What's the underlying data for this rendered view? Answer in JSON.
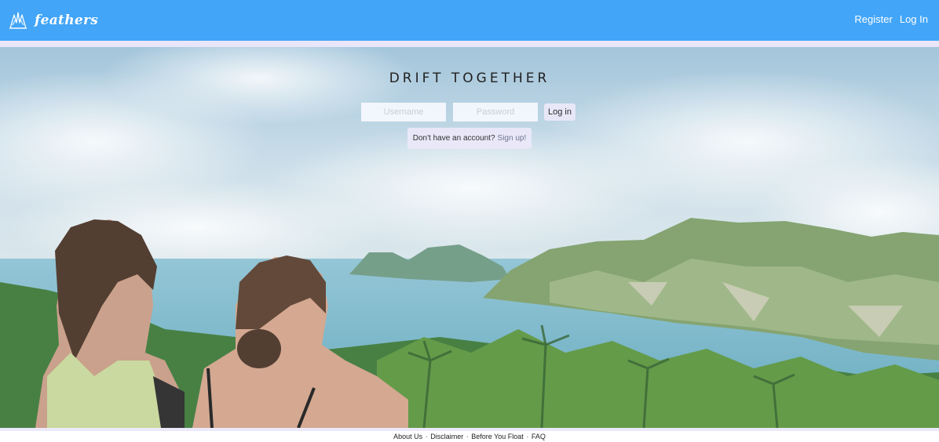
{
  "colors": {
    "navbar": "#42a5f8",
    "nav_strip": "#e8e6f8",
    "form_button_bg": "#ece8f8",
    "title_text": "#1f1f1f"
  },
  "header": {
    "brand_name": "feathers",
    "logo_icon": "feather-wings-icon",
    "links": {
      "register": "Register",
      "login": "Log In"
    }
  },
  "hero": {
    "background_image": "two-women-overlooking-tropical-bay-photo",
    "title": "DRIFT TOGETHER",
    "login_form": {
      "username_placeholder": "Username",
      "password_placeholder": "Password",
      "submit_label": "Log in"
    },
    "signup": {
      "prompt": "Don't have an account?",
      "link": "Sign up!"
    }
  },
  "footer": {
    "links": [
      "About Us",
      "Disclaimer",
      "Before You Float",
      "FAQ"
    ],
    "separator": "·"
  }
}
